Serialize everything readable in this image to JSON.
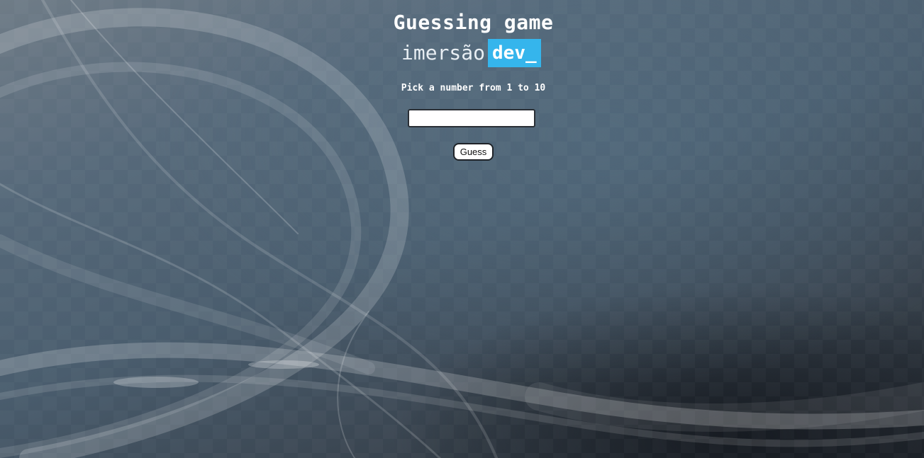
{
  "page": {
    "title": "Guessing game",
    "brand": {
      "main": "imersão",
      "accent": "dev_",
      "accent_color": "#35b5ec"
    },
    "prompt": "Pick a number from 1 to 10",
    "input": {
      "value": "",
      "placeholder": ""
    },
    "button_label": "Guess"
  },
  "icons": {
    "background": "abstract-swirl-wallpaper"
  }
}
